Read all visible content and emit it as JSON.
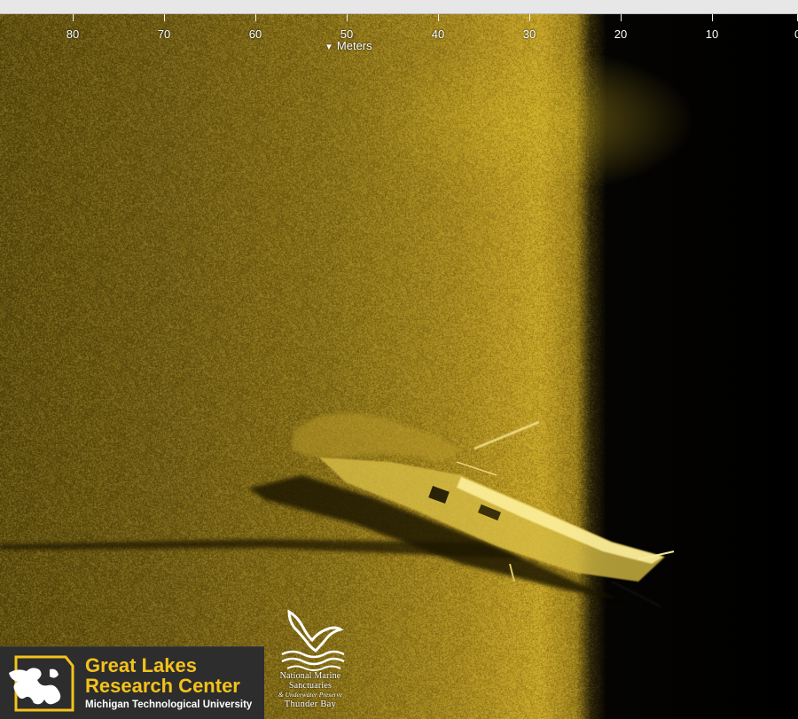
{
  "scale": {
    "ticks": [
      {
        "value": "80"
      },
      {
        "value": "70"
      },
      {
        "value": "60"
      },
      {
        "value": "50"
      },
      {
        "value": "40"
      },
      {
        "value": "30"
      },
      {
        "value": "20"
      },
      {
        "value": "10"
      },
      {
        "value": "0"
      }
    ],
    "units_label": "Meters",
    "units_arrow": "▼"
  },
  "logos": {
    "glrc": {
      "line1": "Great Lakes",
      "line2": "Research Center",
      "subtitle": "Michigan Technological University"
    },
    "nms": {
      "line1": "National Marine",
      "line2": "Sanctuaries",
      "line3": "& Underwater Preserve",
      "line4": "Thunder Bay"
    }
  },
  "colors": {
    "sonar_gold": "#c7a424",
    "logo_gold": "#f4c21c",
    "logo_bg": "#2d2d2d"
  }
}
